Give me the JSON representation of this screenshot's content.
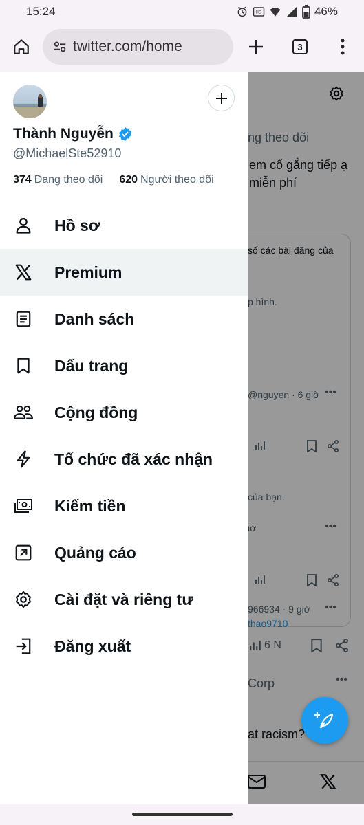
{
  "status_bar": {
    "time": "15:24",
    "battery": "46%"
  },
  "browser": {
    "url": "twitter.com/home",
    "tab_count": "3"
  },
  "profile": {
    "name": "Thành Nguyễn",
    "handle": "@MichaelSte52910",
    "following_count": "374",
    "following_label": "Đang theo dõi",
    "followers_count": "620",
    "followers_label": "Người theo dõi"
  },
  "menu": [
    {
      "label": "Hồ sơ",
      "icon": "person-icon"
    },
    {
      "label": "Premium",
      "icon": "x-logo-icon"
    },
    {
      "label": "Danh sách",
      "icon": "list-icon"
    },
    {
      "label": "Dấu trang",
      "icon": "bookmark-icon"
    },
    {
      "label": "Cộng đồng",
      "icon": "communities-icon"
    },
    {
      "label": "Tổ chức đã xác nhận",
      "icon": "lightning-icon"
    },
    {
      "label": "Kiếm tiền",
      "icon": "money-icon"
    },
    {
      "label": "Quảng cáo",
      "icon": "ads-arrow-icon"
    },
    {
      "label": "Cài đặt và riêng tư",
      "icon": "gear-icon"
    },
    {
      "label": "Đăng xuất",
      "icon": "logout-icon"
    }
  ],
  "feed": {
    "tab_following": "ng theo dõi",
    "promo_line1": "em cố gắng tiếp ạ",
    "promo_line2": "miễn phí",
    "card_line1": "số các bài đăng của",
    "card_line2": "p hình.",
    "post1_meta": "@nguyen · 6 giờ",
    "post2_text": "của bạn.",
    "post2_meta": "iờ",
    "post3_meta": "966934 · 9 giờ",
    "post3_link": "thao9710",
    "views": "6 N",
    "corp": "Corp",
    "question": "at racism?"
  }
}
